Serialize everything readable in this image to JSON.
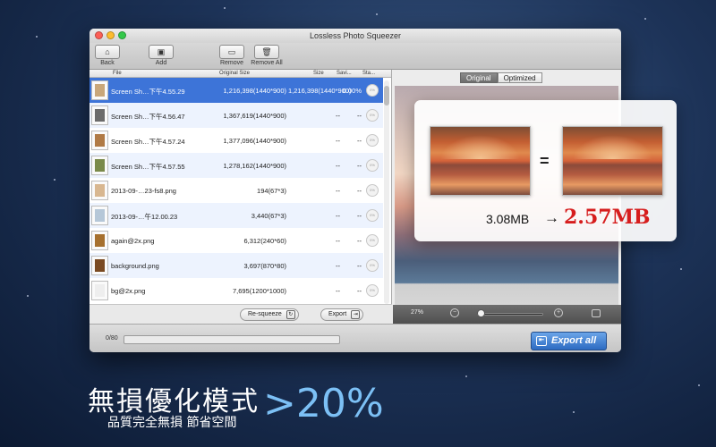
{
  "window": {
    "title": "Lossless Photo Squeezer"
  },
  "toolbar": {
    "back_label": "Back",
    "add_label": "Add",
    "remove_label": "Remove",
    "remove_all_label": "Remove All"
  },
  "table": {
    "headers": {
      "file": "File",
      "original_size": "Original Size",
      "size": "Size",
      "saving": "Savi...",
      "status": "Sta..."
    },
    "rows": [
      {
        "name": "Screen Sh…下午4.55.29",
        "original": "1,216,398(1440*900)",
        "size": "1,216,398(1440*900)",
        "saving": "0.00%",
        "status": "0%",
        "thumb_color": "#c9a77a"
      },
      {
        "name": "Screen Sh…下午4.56.47",
        "original": "1,367,619(1440*900)",
        "size": "--",
        "saving": "--",
        "status": "0%",
        "thumb_color": "#6b6b6b"
      },
      {
        "name": "Screen Sh…下午4.57.24",
        "original": "1,377,096(1440*900)",
        "size": "--",
        "saving": "--",
        "status": "0%",
        "thumb_color": "#b07a45"
      },
      {
        "name": "Screen Sh…下午4.57.55",
        "original": "1,278,162(1440*900)",
        "size": "--",
        "saving": "--",
        "status": "0%",
        "thumb_color": "#7a8a4a"
      },
      {
        "name": "2013-09-…23-fs8.png",
        "original": "194(67*3)",
        "size": "--",
        "saving": "--",
        "status": "0%",
        "thumb_color": "#d8b790"
      },
      {
        "name": "2013-09-…午12.00.23",
        "original": "3,440(67*3)",
        "size": "--",
        "saving": "--",
        "status": "0%",
        "thumb_color": "#b5c7d8"
      },
      {
        "name": "again@2x.png",
        "original": "6,312(240*60)",
        "size": "--",
        "saving": "--",
        "status": "0%",
        "thumb_color": "#a6702e"
      },
      {
        "name": "background.png",
        "original": "3,697(870*80)",
        "size": "--",
        "saving": "--",
        "status": "0%",
        "thumb_color": "#7a4a22"
      },
      {
        "name": "bg@2x.png",
        "original": "7,695(1200*1000)",
        "size": "--",
        "saving": "--",
        "status": "0%",
        "thumb_color": "#eeeeee"
      }
    ]
  },
  "left_bottom": {
    "resqueeze_label": "Re-squeeze",
    "export_label": "Export"
  },
  "preview": {
    "tabs": [
      {
        "label": "Original",
        "active": true
      },
      {
        "label": "Optimized",
        "active": false
      }
    ],
    "zoom_label": "27%",
    "zoom_level": 0.05
  },
  "bottom": {
    "progress_text": "0/80",
    "progress_fraction": 0,
    "export_all_label": "Export all"
  },
  "compare": {
    "before_size": "3.08MB",
    "arrow": "→",
    "after_size": "2.57MB",
    "equals": "="
  },
  "promo": {
    "headline": "無損優化模式",
    "subline": "品質完全無損 節省空間",
    "percent": ">20%"
  },
  "colors": {
    "accent": "#3d74d8",
    "highlight_red": "#d61d1d",
    "promo_blue": "#7cc0f5"
  },
  "icons": {
    "back": "home-icon",
    "add": "add-image-icon",
    "remove": "remove-image-icon",
    "remove_all": "trash-icon",
    "resqueeze": "refresh-icon",
    "export": "export-icon",
    "export_all": "export-all-icon",
    "zoom_out": "zoom-out-icon",
    "zoom_in": "zoom-in-icon",
    "fit": "fit-screen-icon"
  }
}
